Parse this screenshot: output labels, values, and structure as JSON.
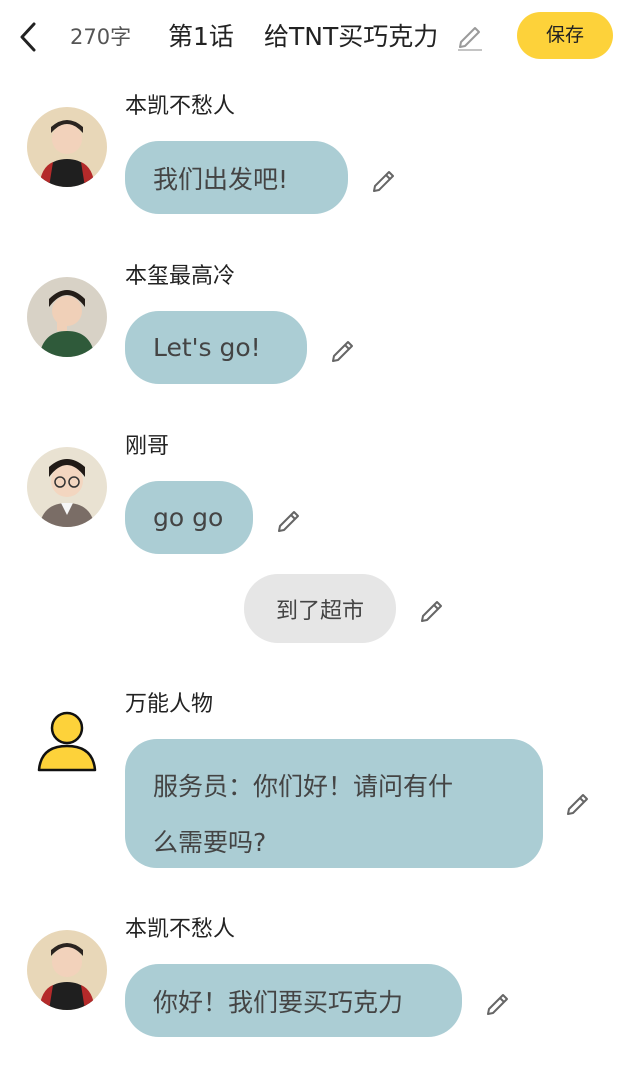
{
  "header": {
    "back_icon": "chevron-left-icon",
    "word_count": "270字",
    "chapter": "第1话",
    "title": "给TNT买巧克力",
    "title_edit_icon": "pencil-icon",
    "save_label": "保存",
    "save_color": "#fdd23a"
  },
  "messages": [
    {
      "type": "chat",
      "name": "本凯不愁人",
      "text": "我们出发吧!",
      "avatar": "avatar-photo"
    },
    {
      "type": "chat",
      "name": "本玺最高冷",
      "text": "Let's go!",
      "avatar": "avatar-photo"
    },
    {
      "type": "chat",
      "name": "刚哥",
      "text": "go go",
      "avatar": "avatar-photo"
    },
    {
      "type": "narration",
      "text": "到了超市"
    },
    {
      "type": "chat",
      "name": "万能人物",
      "text_line1": "服务员：你们好！请问有什",
      "text_line2": "么需要吗?",
      "avatar": "generic-person-icon"
    },
    {
      "type": "chat",
      "name": "本凯不愁人",
      "text": "你好！我们要买巧克力",
      "avatar": "avatar-photo"
    }
  ],
  "colors": {
    "chat_bubble": "#abcdd4",
    "narration_bubble": "#e6e6e6",
    "person_icon": "#fdd23a"
  }
}
